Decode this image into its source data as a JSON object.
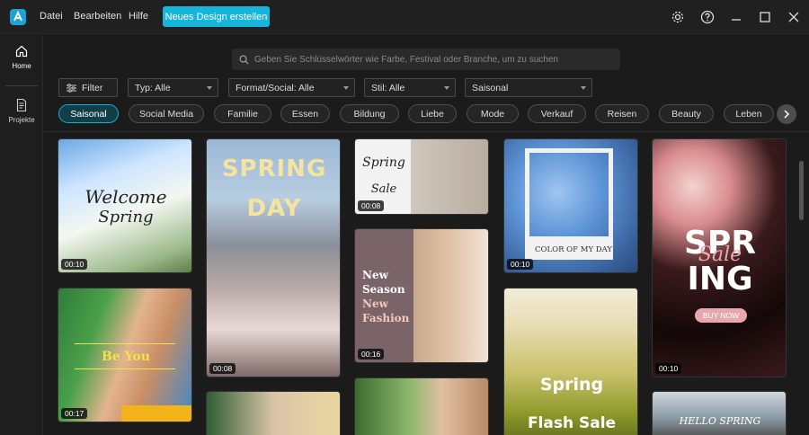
{
  "menu": {
    "file": "Datei",
    "edit": "Bearbeiten",
    "help": "Hilfe",
    "cta": "Neues Design erstellen"
  },
  "sidebar": {
    "home": "Home",
    "projects": "Projekte"
  },
  "search": {
    "placeholder": "Geben Sie Schlüsselwörter wie Farbe, Festival oder Branche, um zu suchen"
  },
  "filters": {
    "filter_label": "Filter",
    "type": "Typ: Alle",
    "format": "Format/Social: Alle",
    "style": "Stil: Alle",
    "season": "Saisonal"
  },
  "categories": [
    "Saisonal",
    "Social Media",
    "Familie",
    "Essen",
    "Bildung",
    "Liebe",
    "Mode",
    "Verkauf",
    "Reisen",
    "Beauty",
    "Leben"
  ],
  "templates": {
    "welcome_spring": {
      "line1": "Welcome",
      "line2": "Spring",
      "duration": "00:10"
    },
    "be_you": {
      "text": "Be You",
      "duration": "00:17"
    },
    "spring_day": {
      "line1": "SPRING",
      "line2": "DAY",
      "duration": "00:08"
    },
    "spring_sale": {
      "line1": "Spring",
      "line2": "Sale",
      "duration": "00:08"
    },
    "new_season": {
      "line1": "New",
      "line2": "Season",
      "line3": "New",
      "line4": "Fashion",
      "duration": "00:16"
    },
    "color_day": {
      "text": "COLOR OF MY DAY",
      "duration": "00:10"
    },
    "flash_sale": {
      "line1": "Spring",
      "line2": "Flash Sale"
    },
    "spring_sale_big": {
      "line1": "SPR",
      "line2": "ING",
      "script": "Sale",
      "button": "BUY NOW",
      "duration": "00:10"
    },
    "hello_spring": {
      "text": "HELLO SPRING"
    }
  },
  "colors": {
    "accent": "#16b5d9",
    "background": "#1b1b1b",
    "titlebar": "#202020"
  }
}
